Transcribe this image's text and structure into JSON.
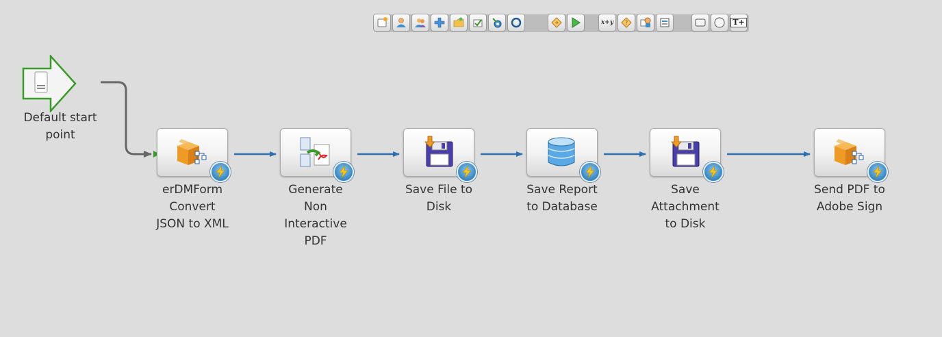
{
  "palette": {
    "tools": [
      {
        "icon": "start-point-icon"
      },
      {
        "icon": "user-task-icon"
      },
      {
        "icon": "user-group-icon"
      },
      {
        "icon": "add-icon"
      },
      {
        "icon": "folder-icon"
      },
      {
        "icon": "wizard-icon"
      },
      {
        "icon": "event-icon"
      },
      {
        "icon": "circle-icon"
      },
      {
        "icon": "gateway-icon"
      },
      {
        "icon": "play-icon"
      },
      {
        "icon": "set-value-icon",
        "text": "x+y"
      },
      {
        "icon": "decision-icon"
      },
      {
        "icon": "subprocess-icon"
      },
      {
        "icon": "form-icon"
      },
      {
        "icon": "rectangle-icon"
      },
      {
        "icon": "ellipse-icon"
      },
      {
        "icon": "text-icon",
        "text": "T+"
      }
    ]
  },
  "start_point": {
    "icon": "start-point-arrow-icon",
    "label_line1": "Default start",
    "label_line2": "point"
  },
  "steps": [
    {
      "icon": "box-flow-icon",
      "badge": "lightning-icon",
      "lines": [
        "erDMForm",
        "Convert",
        "JSON to XML"
      ]
    },
    {
      "icon": "pdf-convert-icon",
      "badge": "lightning-icon",
      "lines": [
        "Generate",
        "Non",
        "Interactive",
        "PDF"
      ]
    },
    {
      "icon": "floppy-disk-icon",
      "badge": "lightning-icon",
      "lines": [
        "Save File to",
        "Disk"
      ]
    },
    {
      "icon": "database-icon",
      "badge": "lightning-icon",
      "lines": [
        "Save Report",
        "to Database"
      ]
    },
    {
      "icon": "floppy-disk-icon",
      "badge": "lightning-icon",
      "lines": [
        "Save",
        "Attachment",
        "to Disk"
      ]
    },
    {
      "icon": "box-flow-icon",
      "badge": "lightning-icon",
      "lines": [
        "Send PDF to",
        "Adobe Sign"
      ]
    }
  ],
  "colors": {
    "canvas": "#dddddd",
    "connector": "#2e6fb0",
    "start_connector": "#666666",
    "start_green": "#3a9a2a",
    "badge_blue": "#3f8ec8",
    "lightning": "#f3c623"
  }
}
